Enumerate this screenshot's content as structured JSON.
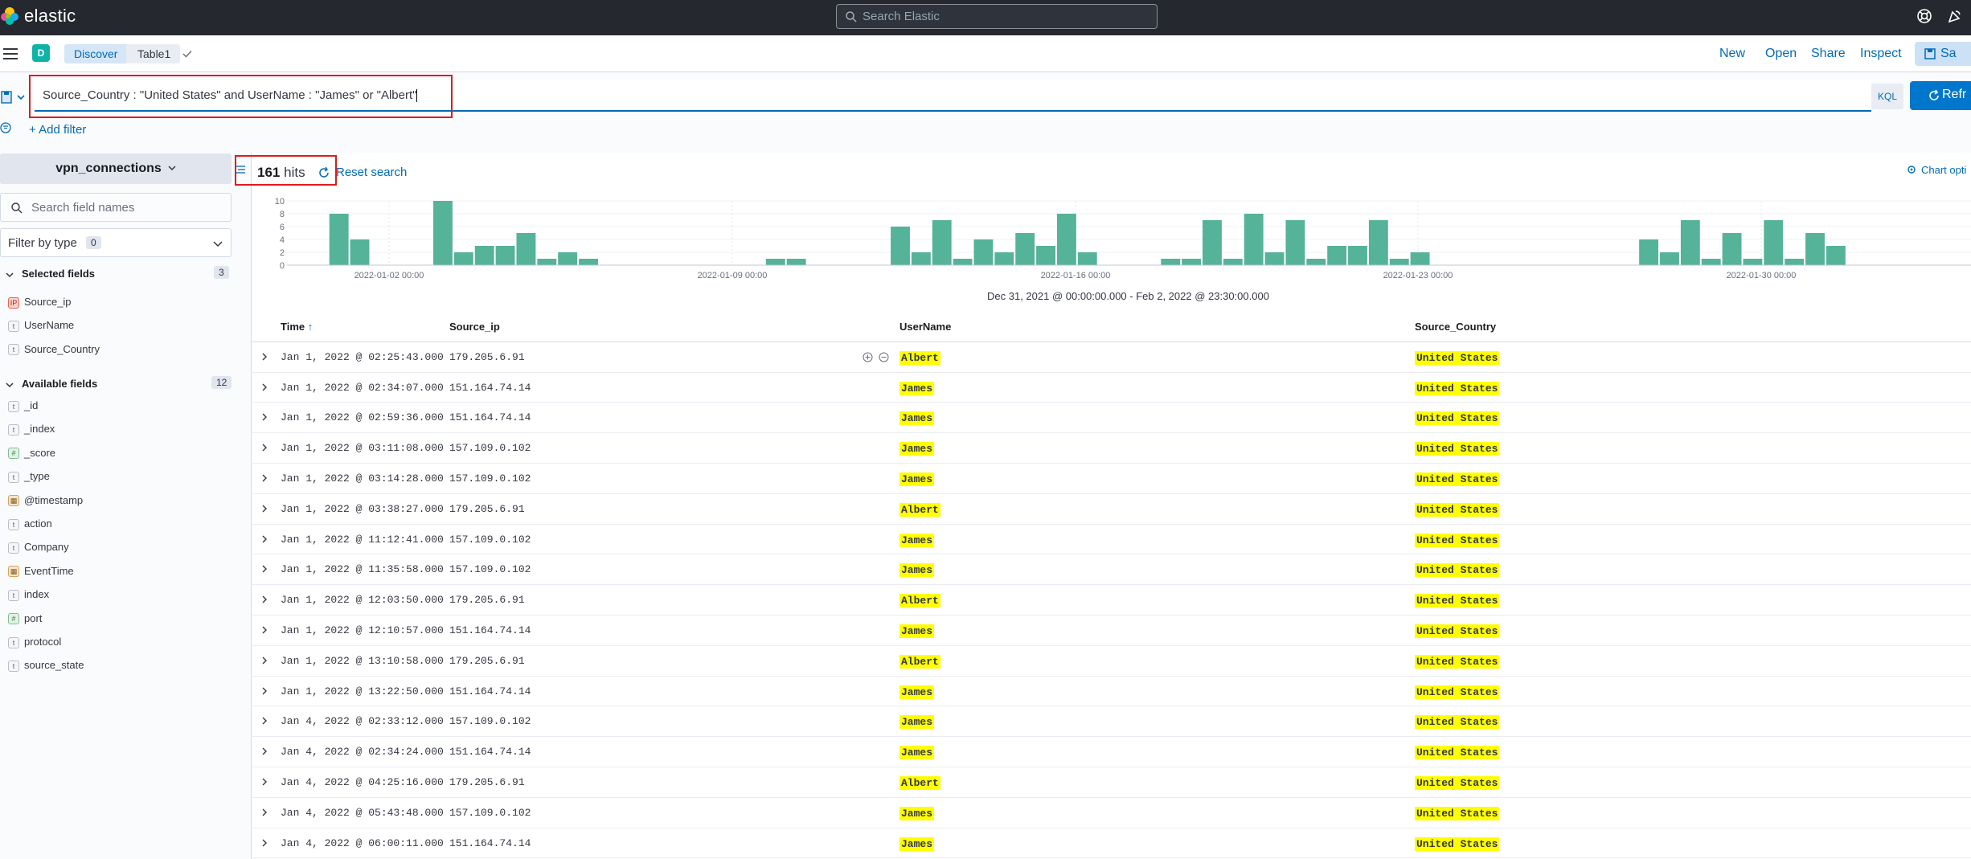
{
  "header": {
    "brand": "elastic",
    "search_placeholder": "Search Elastic"
  },
  "appbar": {
    "space_initial": "D",
    "breadcrumbs": [
      "Discover",
      "Table1"
    ],
    "links": [
      "New",
      "Open",
      "Share",
      "Inspect"
    ],
    "save_label": "Sa"
  },
  "query": {
    "value": "Source_Country : \"United States\" and UserName : \"James\" or \"Albert\"",
    "language": "KQL",
    "refresh_label": "Refr",
    "add_filter": "+ Add filter"
  },
  "sidebar": {
    "index_pattern": "vpn_connections",
    "field_search_placeholder": "Search field names",
    "filter_by_type_label": "Filter by type",
    "filter_by_type_count": "0",
    "selected_title": "Selected fields",
    "selected_count": "3",
    "selected_fields": [
      {
        "name": "Source_ip",
        "type": "ip"
      },
      {
        "name": "UserName",
        "type": "string"
      },
      {
        "name": "Source_Country",
        "type": "string"
      }
    ],
    "available_title": "Available fields",
    "available_count": "12",
    "available_fields": [
      {
        "name": "_id",
        "type": "string"
      },
      {
        "name": "_index",
        "type": "string"
      },
      {
        "name": "_score",
        "type": "number"
      },
      {
        "name": "_type",
        "type": "string"
      },
      {
        "name": "@timestamp",
        "type": "date"
      },
      {
        "name": "action",
        "type": "string"
      },
      {
        "name": "Company",
        "type": "string"
      },
      {
        "name": "EventTime",
        "type": "date"
      },
      {
        "name": "index",
        "type": "string"
      },
      {
        "name": "port",
        "type": "number"
      },
      {
        "name": "protocol",
        "type": "string"
      },
      {
        "name": "source_state",
        "type": "string"
      }
    ]
  },
  "results": {
    "hits_count": "161",
    "hits_label": "hits",
    "reset_label": "Reset search",
    "chart_options": "Chart opti",
    "time_range": "Dec 31, 2021 @ 00:00:00.000 - Feb 2, 2022 @ 23:30:00.000"
  },
  "chart_data": {
    "type": "bar",
    "bar_color": "#54b399",
    "ylim": [
      0,
      10
    ],
    "y_ticks": [
      "10",
      "8",
      "6",
      "4",
      "2",
      "0"
    ],
    "x_ticks": [
      "2022-01-02 00:00",
      "2022-01-09 00:00",
      "2022-01-16 00:00",
      "2022-01-23 00:00",
      "2022-01-30 00:00"
    ],
    "values": [
      0,
      0,
      8,
      4,
      0,
      0,
      0,
      10,
      2,
      3,
      3,
      5,
      1,
      2,
      1,
      0,
      0,
      0,
      0,
      0,
      0,
      0,
      0,
      1,
      1,
      0,
      0,
      0,
      0,
      6,
      2,
      7,
      1,
      4,
      2,
      5,
      3,
      8,
      2,
      0,
      0,
      0,
      1,
      1,
      7,
      1,
      8,
      2,
      7,
      1,
      3,
      3,
      7,
      1,
      2,
      0,
      0,
      0,
      0,
      0,
      0,
      0,
      0,
      0,
      0,
      4,
      2,
      7,
      1,
      5,
      1,
      7,
      1,
      5,
      3,
      0,
      0,
      0,
      0,
      0,
      0
    ]
  },
  "table": {
    "columns": [
      "Time",
      "Source_ip",
      "UserName",
      "Source_Country"
    ],
    "rows": [
      {
        "time": "Jan 1, 2022 @ 02:25:43.000",
        "ip": "179.205.6.91",
        "user": "Albert",
        "country": "United States"
      },
      {
        "time": "Jan 1, 2022 @ 02:34:07.000",
        "ip": "151.164.74.14",
        "user": "James",
        "country": "United States"
      },
      {
        "time": "Jan 1, 2022 @ 02:59:36.000",
        "ip": "151.164.74.14",
        "user": "James",
        "country": "United States"
      },
      {
        "time": "Jan 1, 2022 @ 03:11:08.000",
        "ip": "157.109.0.102",
        "user": "James",
        "country": "United States"
      },
      {
        "time": "Jan 1, 2022 @ 03:14:28.000",
        "ip": "157.109.0.102",
        "user": "James",
        "country": "United States"
      },
      {
        "time": "Jan 1, 2022 @ 03:38:27.000",
        "ip": "179.205.6.91",
        "user": "Albert",
        "country": "United States"
      },
      {
        "time": "Jan 1, 2022 @ 11:12:41.000",
        "ip": "157.109.0.102",
        "user": "James",
        "country": "United States"
      },
      {
        "time": "Jan 1, 2022 @ 11:35:58.000",
        "ip": "157.109.0.102",
        "user": "James",
        "country": "United States"
      },
      {
        "time": "Jan 1, 2022 @ 12:03:50.000",
        "ip": "179.205.6.91",
        "user": "Albert",
        "country": "United States"
      },
      {
        "time": "Jan 1, 2022 @ 12:10:57.000",
        "ip": "151.164.74.14",
        "user": "James",
        "country": "United States"
      },
      {
        "time": "Jan 1, 2022 @ 13:10:58.000",
        "ip": "179.205.6.91",
        "user": "Albert",
        "country": "United States"
      },
      {
        "time": "Jan 1, 2022 @ 13:22:50.000",
        "ip": "151.164.74.14",
        "user": "James",
        "country": "United States"
      },
      {
        "time": "Jan 4, 2022 @ 02:33:12.000",
        "ip": "157.109.0.102",
        "user": "James",
        "country": "United States"
      },
      {
        "time": "Jan 4, 2022 @ 02:34:24.000",
        "ip": "151.164.74.14",
        "user": "James",
        "country": "United States"
      },
      {
        "time": "Jan 4, 2022 @ 04:25:16.000",
        "ip": "179.205.6.91",
        "user": "Albert",
        "country": "United States"
      },
      {
        "time": "Jan 4, 2022 @ 05:43:48.000",
        "ip": "157.109.0.102",
        "user": "James",
        "country": "United States"
      },
      {
        "time": "Jan 4, 2022 @ 06:00:11.000",
        "ip": "151.164.74.14",
        "user": "James",
        "country": "United States"
      }
    ]
  }
}
